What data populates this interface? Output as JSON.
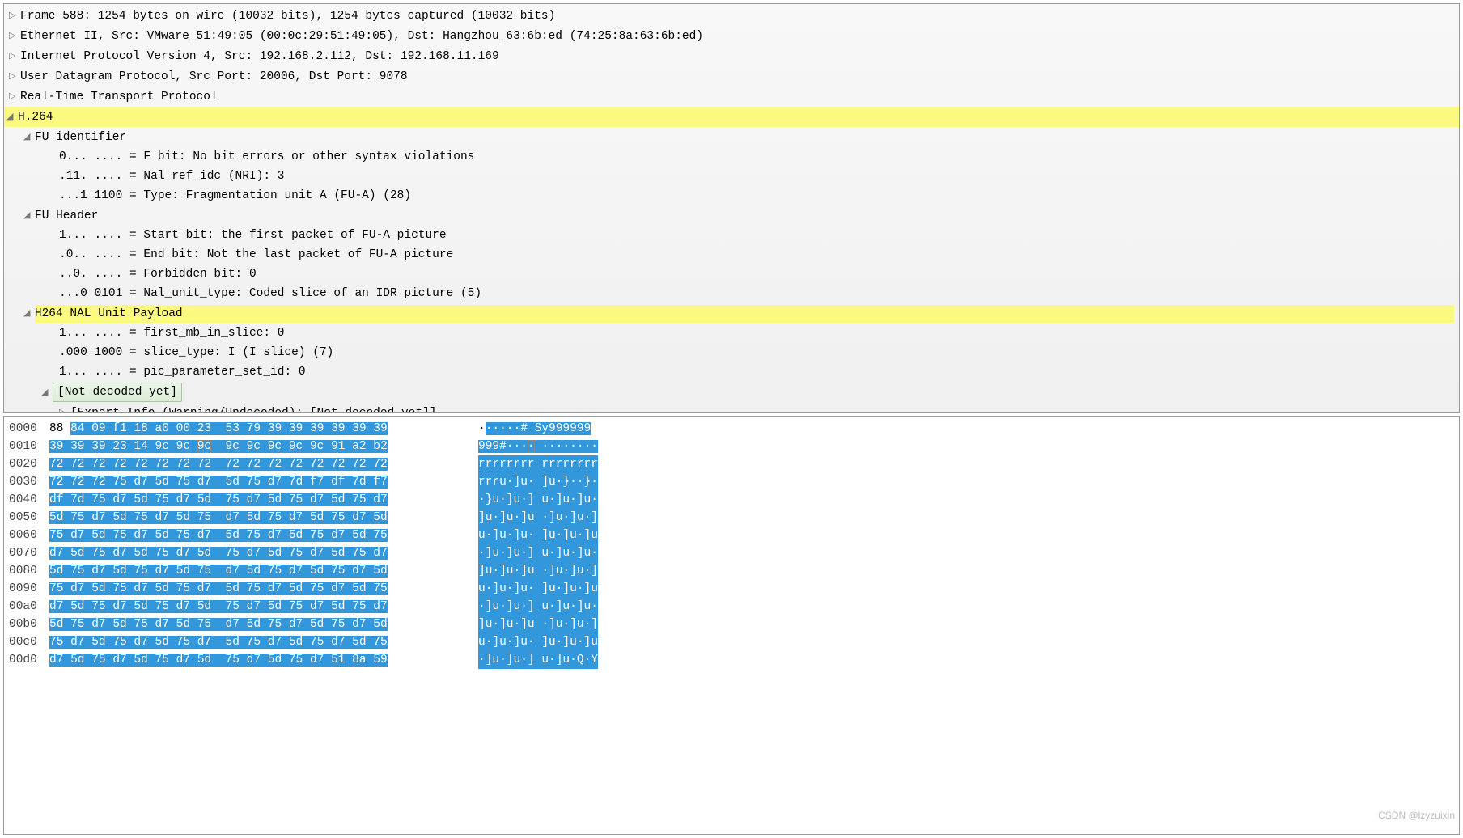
{
  "tree": {
    "frame": "Frame 588: 1254 bytes on wire (10032 bits), 1254 bytes captured (10032 bits)",
    "eth": "Ethernet II, Src: VMware_51:49:05 (00:0c:29:51:49:05), Dst: Hangzhou_63:6b:ed (74:25:8a:63:6b:ed)",
    "ip": "Internet Protocol Version 4, Src: 192.168.2.112, Dst: 192.168.11.169",
    "udp": "User Datagram Protocol, Src Port: 20006, Dst Port: 9078",
    "rtp": "Real-Time Transport Protocol",
    "h264": "H.264",
    "fu_id": "FU identifier",
    "fbit": "0... .... = F bit: No bit errors or other syntax violations",
    "nri": ".11. .... = Nal_ref_idc (NRI): 3",
    "type": "...1 1100 = Type: Fragmentation unit A (FU-A) (28)",
    "fu_hdr": "FU Header",
    "start": "1... .... = Start bit: the first packet of FU-A picture",
    "end": ".0.. .... = End bit: Not the last packet of FU-A picture",
    "forbid": "..0. .... = Forbidden bit: 0",
    "naltype": "...0 0101 = Nal_unit_type: Coded slice of an IDR picture (5)",
    "payload": "H264 NAL Unit Payload",
    "firstmb": "1... .... = first_mb_in_slice: 0",
    "slicetype": ".000 1000 = slice_type: I (I slice) (7)",
    "ppsid": "1... .... = pic_parameter_set_id: 0",
    "notdecoded": "[Not decoded yet]",
    "expert": "[Expert Info (Warning/Undecoded): [Not decoded yet]]"
  },
  "hex": [
    {
      "off": "0000",
      "h1": "88 ",
      "h1sel": "84 09 f1 18 a0 00 23",
      "h2": "  53 79 39 39 39 39 39 39",
      "a0": "·",
      "asel": "·····# ",
      "a0b": "Sy999999"
    },
    {
      "off": "0010",
      "h1": "39 39 39 23 14 9c 9c ",
      "hb": "9c",
      "h2": "  9c 9c 9c 9c 9c 91 a2 b2",
      "a": "999#···",
      "ab": "·",
      "a2": " ········"
    },
    {
      "off": "0020",
      "h1": "72 72 72 72 72 72 72 72",
      "h2": "  72 72 72 72 72 72 72 72",
      "a": "rrrrrrrr rrrrrrrr"
    },
    {
      "off": "0030",
      "h1": "72 72 72 75 d7 5d 75 d7",
      "h2": "  5d 75 d7 7d f7 df 7d f7",
      "a": "rrru·]u· ]u·}··}·"
    },
    {
      "off": "0040",
      "h1": "df 7d 75 d7 5d 75 d7 5d",
      "h2": "  75 d7 5d 75 d7 5d 75 d7",
      "a": "·}u·]u·] u·]u·]u·"
    },
    {
      "off": "0050",
      "h1": "5d 75 d7 5d 75 d7 5d 75",
      "h2": "  d7 5d 75 d7 5d 75 d7 5d",
      "a": "]u·]u·]u ·]u·]u·]"
    },
    {
      "off": "0060",
      "h1": "75 d7 5d 75 d7 5d 75 d7",
      "h2": "  5d 75 d7 5d 75 d7 5d 75",
      "a": "u·]u·]u· ]u·]u·]u"
    },
    {
      "off": "0070",
      "h1": "d7 5d 75 d7 5d 75 d7 5d",
      "h2": "  75 d7 5d 75 d7 5d 75 d7",
      "a": "·]u·]u·] u·]u·]u·"
    },
    {
      "off": "0080",
      "h1": "5d 75 d7 5d 75 d7 5d 75",
      "h2": "  d7 5d 75 d7 5d 75 d7 5d",
      "a": "]u·]u·]u ·]u·]u·]"
    },
    {
      "off": "0090",
      "h1": "75 d7 5d 75 d7 5d 75 d7",
      "h2": "  5d 75 d7 5d 75 d7 5d 75",
      "a": "u·]u·]u· ]u·]u·]u"
    },
    {
      "off": "00a0",
      "h1": "d7 5d 75 d7 5d 75 d7 5d",
      "h2": "  75 d7 5d 75 d7 5d 75 d7",
      "a": "·]u·]u·] u·]u·]u·"
    },
    {
      "off": "00b0",
      "h1": "5d 75 d7 5d 75 d7 5d 75",
      "h2": "  d7 5d 75 d7 5d 75 d7 5d",
      "a": "]u·]u·]u ·]u·]u·]"
    },
    {
      "off": "00c0",
      "h1": "75 d7 5d 75 d7 5d 75 d7",
      "h2": "  5d 75 d7 5d 75 d7 5d 75",
      "a": "u·]u·]u· ]u·]u·]u"
    },
    {
      "off": "00d0",
      "h1": "d7 5d 75 d7 5d 75 d7 5d",
      "h2": "  75 d7 5d 75 d7 51 8a 59",
      "a": "·]u·]u·] u·]u·Q·Y"
    }
  ],
  "watermark": "CSDN @lzyzuixin"
}
